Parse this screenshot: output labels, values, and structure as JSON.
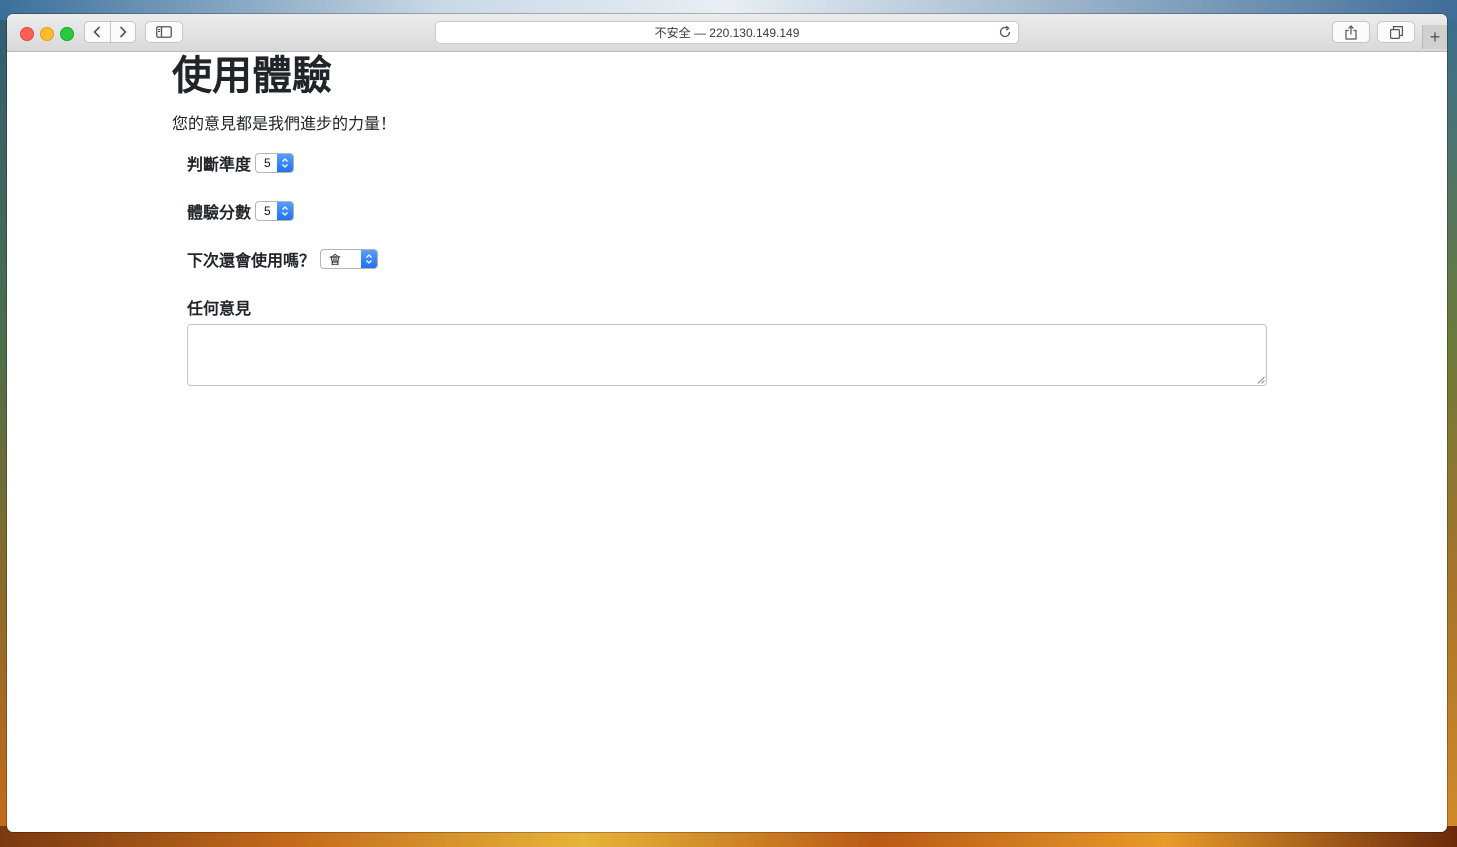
{
  "browser": {
    "address": "不安全 — 220.130.149.149",
    "new_tab_glyph": "+"
  },
  "page": {
    "title": "使用體驗",
    "subtitle": "您的意見都是我們進步的力量！",
    "fields": {
      "accuracy": {
        "label": "判斷準度",
        "value": "5"
      },
      "experience": {
        "label": "體驗分數",
        "value": "5"
      },
      "reuse": {
        "label": "下次還會使用嗎？",
        "value": "會"
      },
      "comments": {
        "label": "任何意見",
        "value": ""
      }
    }
  },
  "colors": {
    "select_accent": "#1f6fe8",
    "text": "#212529"
  }
}
